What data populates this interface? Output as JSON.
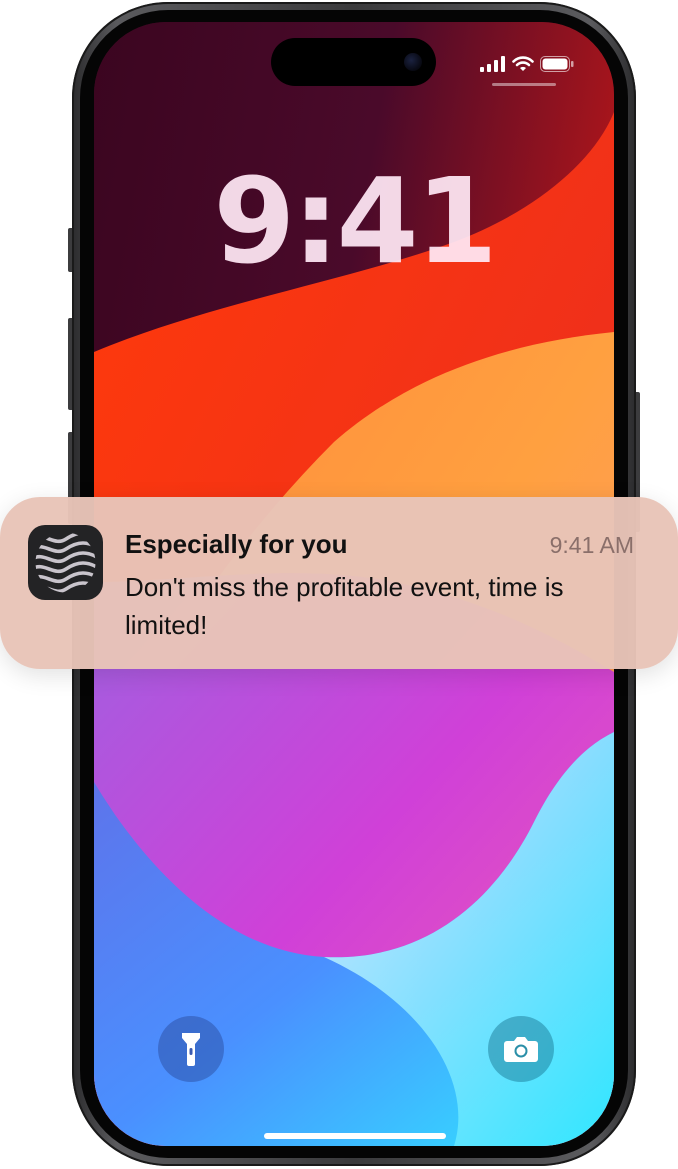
{
  "lock_screen": {
    "time": "9:41"
  },
  "status_bar": {
    "icons": [
      "signal-icon",
      "wifi-icon",
      "battery-icon"
    ]
  },
  "notification": {
    "title": "Especially for you",
    "time": "9:41 AM",
    "body": "Don't miss the profitable event, time is limited!",
    "app_icon": "wave-app-icon"
  },
  "bottom_controls": {
    "left": "flashlight-icon",
    "right": "camera-icon"
  },
  "colors": {
    "notification_bg": "#e8c4b8",
    "clock": "#ffe8f5",
    "app_icon_bg": "#232325"
  }
}
